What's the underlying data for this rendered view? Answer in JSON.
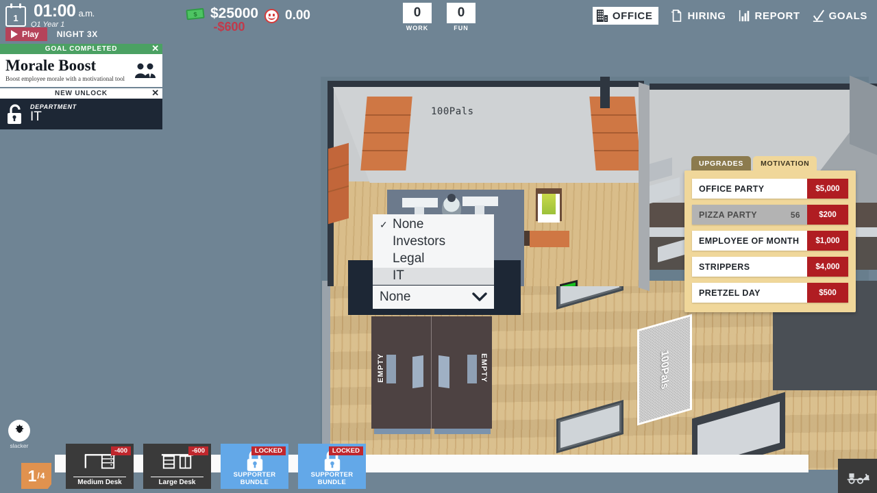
{
  "hud": {
    "calendar_day": "1",
    "time": "01:00",
    "meridiem": "a.m.",
    "quarter_year": "Q1 Year 1",
    "play_label": "Play",
    "speed_label": "NIGHT 3X",
    "money": "$25000",
    "money_delta": "-$600",
    "mood": "0.00",
    "stats": [
      {
        "value": "0",
        "caption": "WORK"
      },
      {
        "value": "0",
        "caption": "FUN"
      }
    ],
    "nav": [
      {
        "label": "OFFICE",
        "icon": "building-icon",
        "active": true
      },
      {
        "label": "HIRING",
        "icon": "document-icon",
        "active": false
      },
      {
        "label": "REPORT",
        "icon": "bar-chart-icon",
        "active": false
      },
      {
        "label": "GOALS",
        "icon": "checkmark-icon",
        "active": false
      }
    ]
  },
  "notifications": [
    {
      "header": "GOAL COMPLETED",
      "title": "Morale Boost",
      "subtitle": "Boost employee morale with a motivational tool",
      "icon": "two-people-icon",
      "close": "✕",
      "style": "green"
    },
    {
      "header": "NEW UNLOCK",
      "category": "DEPARTMENT",
      "title": "IT",
      "icon": "open-lock-icon",
      "close": "✕",
      "style": "white"
    }
  ],
  "dropdown": {
    "selected": "None",
    "checkmark": "✓",
    "options": [
      "None",
      "Investors",
      "Legal",
      "IT"
    ],
    "highlighted": "IT"
  },
  "side_panel": {
    "tabs": [
      {
        "label": "UPGRADES",
        "active": false
      },
      {
        "label": "MOTIVATION",
        "active": true
      }
    ],
    "items": [
      {
        "name": "OFFICE PARTY",
        "count": "",
        "cost": "$5,000",
        "disabled": false
      },
      {
        "name": "PIZZA PARTY",
        "count": "56",
        "cost": "$200",
        "disabled": true
      },
      {
        "name": "EMPLOYEE OF MONTH",
        "count": "",
        "cost": "$1,000",
        "disabled": false
      },
      {
        "name": "STRIPPERS",
        "count": "",
        "cost": "$4,000",
        "disabled": false
      },
      {
        "name": "PRETZEL DAY",
        "count": "",
        "cost": "$500",
        "disabled": false
      }
    ]
  },
  "bottom_bar": {
    "slacker_label": "slacker",
    "page_current": "1",
    "page_total": "4",
    "page_sep": "/",
    "items": [
      {
        "label": "Medium Desk",
        "price": "-400",
        "locked": false,
        "icon": "medium-desk-icon"
      },
      {
        "label": "Large Desk",
        "price": "-600",
        "locked": false,
        "icon": "large-desk-icon"
      },
      {
        "label": "SUPPORTER BUNDLE",
        "price": "LOCKED",
        "locked": true,
        "icon": "lock-icon"
      },
      {
        "label": "SUPPORTER BUNDLE",
        "price": "LOCKED",
        "locked": true,
        "icon": "lock-icon"
      }
    ],
    "bulldoze_icon": "bulldozer-icon"
  },
  "scene": {
    "company_sign_top": "100Pals",
    "rug_label": "100Pals",
    "empty_desk_left": "EMPTY",
    "empty_desk_right": "EMPTY"
  },
  "colors": {
    "sky": "#6f8494",
    "panel_cream": "#f0d79a",
    "cost_red": "#b01d22",
    "accent_navy": "#1d2735",
    "goal_green": "#4ba163",
    "play_pink": "#b5435a",
    "locked_blue": "#63a8e8",
    "floor_wood": "#d9bd8a"
  }
}
